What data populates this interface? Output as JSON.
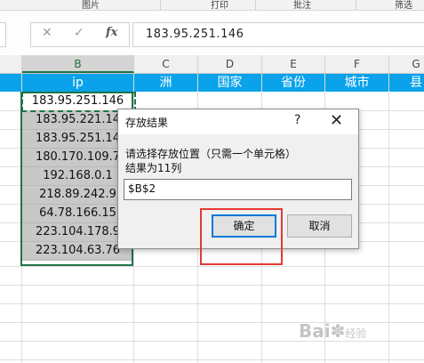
{
  "ribbon": {
    "groups": [
      "图片",
      "打印",
      "批注",
      "筛选"
    ]
  },
  "formula_bar": {
    "value": "183.95.251.146",
    "fx_label": "fx"
  },
  "columns": [
    "B",
    "C",
    "D",
    "E",
    "F",
    "G"
  ],
  "header_row": {
    "B": "ip",
    "C": "洲",
    "D": "国家",
    "E": "省份",
    "F": "城市",
    "G": "县"
  },
  "ip_cells": [
    "183.95.251.146",
    "183.95.221.14",
    "183.95.251.14",
    "180.170.109.7",
    "192.168.0.1",
    "218.89.242.9",
    "64.78.166.15",
    "223.104.178.9",
    "223.104.63.76"
  ],
  "dialog": {
    "title": "存放结果",
    "help_icon": "?",
    "close_icon": "✕",
    "prompt": "请选择存放位置（只需一个单元格）",
    "result_text": "结果为11列",
    "input_value": "$B$2",
    "ok_label": "确定",
    "cancel_label": "取消"
  },
  "watermark": {
    "text": "Bai",
    "subtext": "经验"
  },
  "colors": {
    "header_blue": "#0aa2ea",
    "selection_green": "#217346",
    "highlight_red": "#e53935",
    "focus_blue": "#0078d7"
  }
}
